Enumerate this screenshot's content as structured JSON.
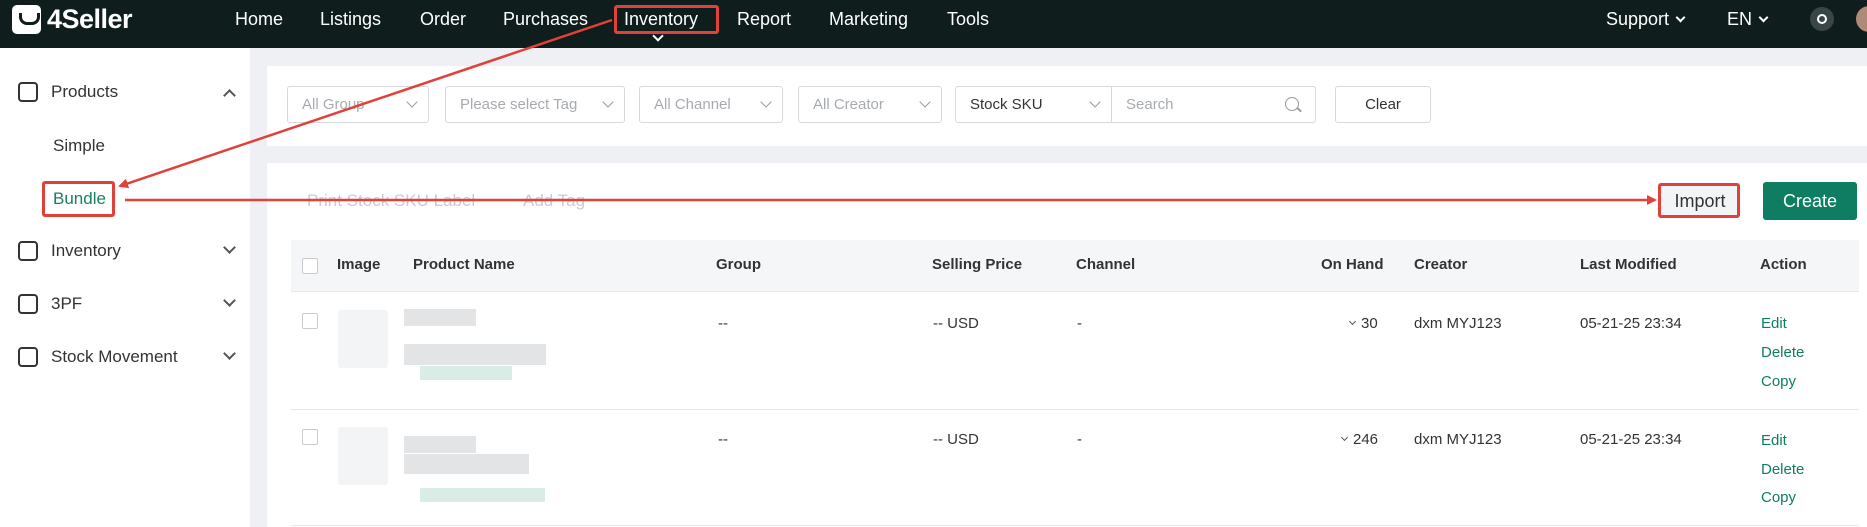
{
  "brand": {
    "name": "4Seller"
  },
  "topnav": {
    "items": [
      "Home",
      "Listings",
      "Order",
      "Purchases",
      "Inventory",
      "Report",
      "Marketing",
      "Tools"
    ],
    "active": "Inventory",
    "support_label": "Support",
    "language_label": "EN"
  },
  "sidebar": {
    "items": [
      {
        "label": "Products",
        "icon": "products-icon",
        "expanded": true
      },
      {
        "label": "Inventory",
        "icon": "inventory-icon",
        "expanded": false
      },
      {
        "label": "3PF",
        "icon": "warehouse-icon",
        "expanded": false
      },
      {
        "label": "Stock Movement",
        "icon": "stock-movement-icon",
        "expanded": false
      }
    ],
    "sub_items": [
      "Simple",
      "Bundle"
    ],
    "active_sub": "Bundle"
  },
  "filters": {
    "group": "All Group",
    "tag": "Please select Tag",
    "channel": "All Channel",
    "creator": "All Creator",
    "search_type": "Stock SKU",
    "search_placeholder": "Search",
    "clear_label": "Clear"
  },
  "toolbar": {
    "print_label": "Print Stock SKU Label",
    "add_tag_label": "Add Tag",
    "import_label": "Import",
    "create_label": "Create"
  },
  "table": {
    "columns": [
      "Image",
      "Product Name",
      "Group",
      "Selling Price",
      "Channel",
      "On Hand",
      "Creator",
      "Last Modified",
      "Action"
    ],
    "rows": [
      {
        "group": "--",
        "selling_price": "-- USD",
        "channel": "-",
        "on_hand": "30",
        "creator": "dxm MYJ123",
        "last_modified": "05-21-25 23:34",
        "actions": [
          "Edit",
          "Delete",
          "Copy"
        ]
      },
      {
        "group": "--",
        "selling_price": "-- USD",
        "channel": "-",
        "on_hand": "246",
        "creator": "dxm MYJ123",
        "last_modified": "05-21-25 23:34",
        "actions": [
          "Edit",
          "Delete",
          "Copy"
        ]
      }
    ]
  },
  "colors": {
    "accent": "#0e7d61",
    "topbar": "#0f1d1d",
    "annotation": "#e0413a"
  }
}
